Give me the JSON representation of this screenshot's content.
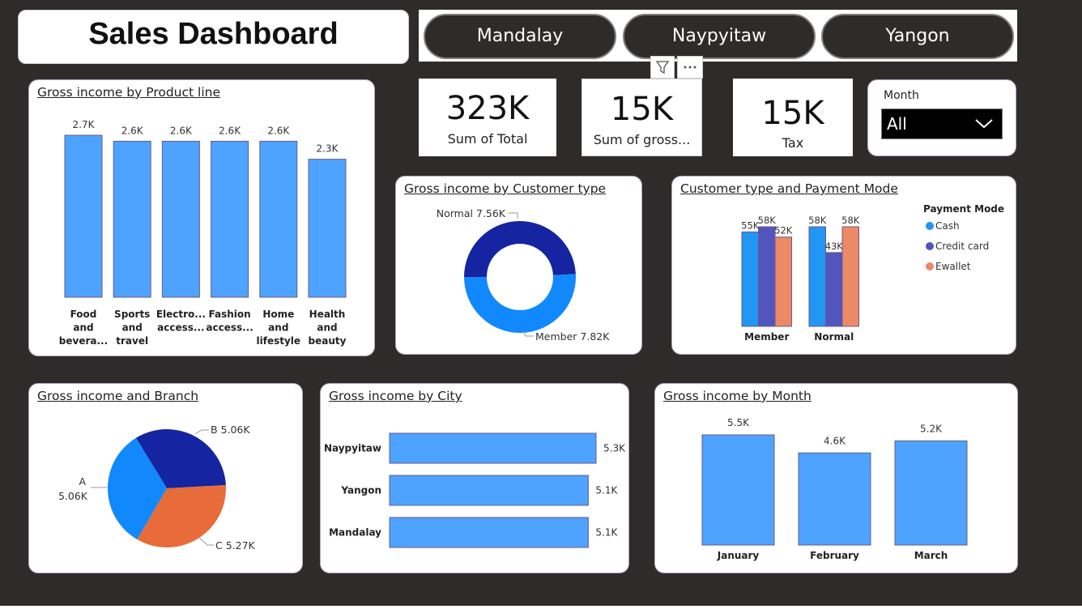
{
  "header": {
    "title": "Sales Dashboard"
  },
  "city_slicer": {
    "buttons": [
      "Mandalay",
      "Naypyitaw",
      "Yangon"
    ]
  },
  "kpis": {
    "total": {
      "value": "323K",
      "label": "Sum of Total"
    },
    "gross": {
      "value": "15K",
      "label": "Sum of gross..."
    },
    "tax": {
      "value": "15K",
      "label": "Tax"
    }
  },
  "month_filter": {
    "label": "Month",
    "selected": "All"
  },
  "colors": {
    "bar": "#4da3ff",
    "cash": "#2196f3",
    "credit": "#5255bd",
    "ewallet": "#ec8a66",
    "dark_blue": "#1524a0",
    "mid_blue": "#1189fd",
    "orange": "#e86b3a"
  },
  "chart_data": [
    {
      "id": "product_line",
      "type": "bar",
      "title": "Gross income by Product line",
      "categories": [
        [
          "Food",
          "and",
          "bevera..."
        ],
        [
          "Sports",
          "and",
          "travel"
        ],
        [
          "Electro...",
          "access..."
        ],
        [
          "Fashion",
          "access..."
        ],
        [
          "Home",
          "and",
          "lifestyle"
        ],
        [
          "Health",
          "and",
          "beauty"
        ]
      ],
      "values": [
        2.7,
        2.6,
        2.6,
        2.6,
        2.6,
        2.3
      ],
      "labels": [
        "2.7K",
        "2.6K",
        "2.6K",
        "2.6K",
        "2.6K",
        "2.3K"
      ],
      "ylim": [
        0,
        2.7
      ]
    },
    {
      "id": "customer_type",
      "type": "pie",
      "title": "Gross income by Customer type",
      "slices": [
        {
          "name": "Normal",
          "value": 7.56,
          "label": "Normal 7.56K"
        },
        {
          "name": "Member",
          "value": 7.82,
          "label": "Member 7.82K"
        }
      ]
    },
    {
      "id": "payment_mode",
      "type": "bar",
      "title": "Customer type and Payment Mode",
      "legend_title": "Payment Mode",
      "categories": [
        "Member",
        "Normal"
      ],
      "series": [
        {
          "name": "Cash",
          "values": [
            55,
            58
          ],
          "labels": [
            "55K",
            "58K"
          ]
        },
        {
          "name": "Credit card",
          "values": [
            58,
            43
          ],
          "labels": [
            "58K",
            "43K"
          ]
        },
        {
          "name": "Ewallet",
          "values": [
            52,
            58
          ],
          "labels": [
            "52K",
            "58K"
          ]
        }
      ],
      "ylim": [
        0,
        58
      ]
    },
    {
      "id": "branch",
      "type": "pie",
      "title": "Gross income and Branch",
      "slices": [
        {
          "name": "B",
          "value": 5.06,
          "label": "B 5.06K"
        },
        {
          "name": "C",
          "value": 5.27,
          "label": "C 5.27K"
        },
        {
          "name": "A",
          "value": 5.06,
          "label_line1": "A",
          "label_line2": "5.06K"
        }
      ]
    },
    {
      "id": "city",
      "type": "bar",
      "title": "Gross income by City",
      "categories": [
        "Naypyitaw",
        "Yangon",
        "Mandalay"
      ],
      "values": [
        5.3,
        5.1,
        5.1
      ],
      "labels": [
        "5.3K",
        "5.1K",
        "5.1K"
      ],
      "xlim": [
        0,
        5.3
      ]
    },
    {
      "id": "month",
      "type": "bar",
      "title": "Gross income by Month",
      "categories": [
        "January",
        "February",
        "March"
      ],
      "values": [
        5.5,
        4.6,
        5.2
      ],
      "labels": [
        "5.5K",
        "4.6K",
        "5.2K"
      ],
      "ylim": [
        0,
        5.5
      ]
    }
  ]
}
